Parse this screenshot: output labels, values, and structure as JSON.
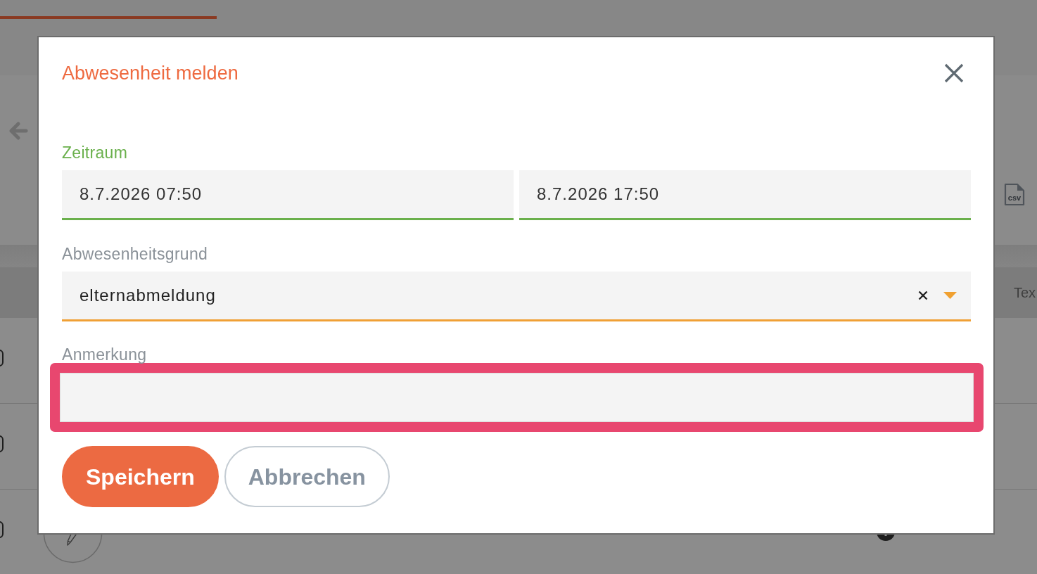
{
  "background_page": {
    "export_label": "csv",
    "table_columns": [
      "Tex"
    ],
    "rows": [
      {
        "checked": false
      },
      {
        "checked": false
      },
      {
        "checked": false
      }
    ]
  },
  "dialog": {
    "title": "Abwesenheit melden",
    "fields": [
      {
        "kind": "date_range",
        "label": "Zeitraum",
        "valid": true,
        "focused": false,
        "values": [
          "8.7.2026 07:50",
          "8.7.2026 17:50"
        ]
      },
      {
        "kind": "select",
        "label": "Abwesenheitsgrund",
        "valid": false,
        "focused": true,
        "value": "elternabmeldung"
      },
      {
        "kind": "textarea",
        "label": "Anmerkung",
        "valid": false,
        "focused": false,
        "highlighted": true
      }
    ],
    "buttons": [
      {
        "label": "Speichern",
        "kind": "primary"
      },
      {
        "label": "Abbrechen",
        "kind": "secondary"
      }
    ]
  }
}
